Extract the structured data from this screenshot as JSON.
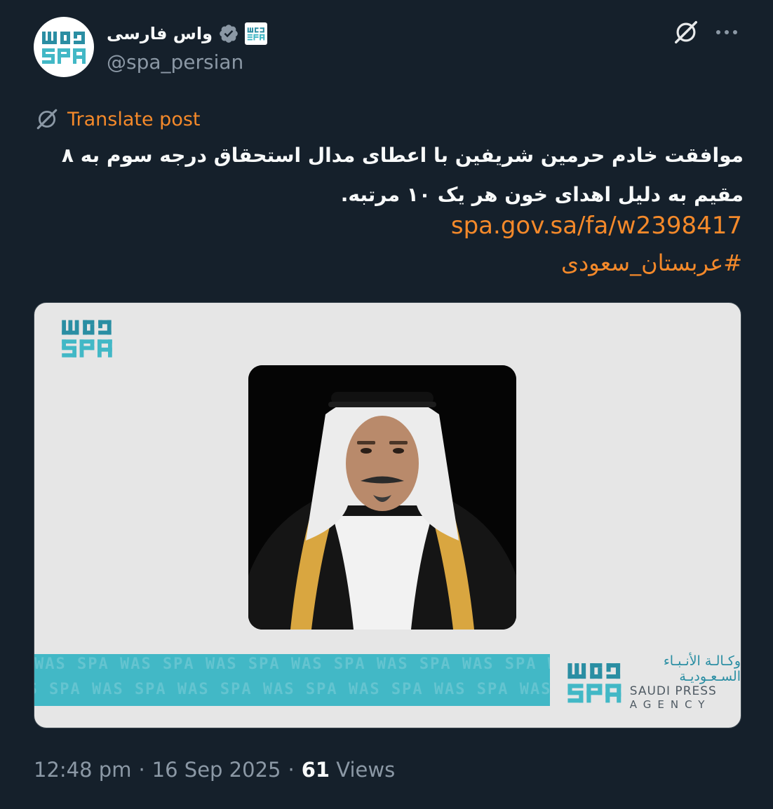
{
  "author": {
    "display_name": "واس فارسی",
    "handle": "@spa_persian",
    "verified": true,
    "avatar_mark": "WAS SPA"
  },
  "post": {
    "translate_label": "Translate post",
    "text": "موافقت خادم حرمین شریفین با اعطای مدال استحقاق درجه سوم به ۸ مقیم به دلیل اهدای خون هر یک ۱۰ مرتبه.",
    "link": "spa.gov.sa/fa/w2398417",
    "hashtag": "#عربستان_سعودی"
  },
  "media": {
    "logo_mark": "SPA",
    "agency_name_ar": "وكـالـة الأنـبـاء السـعـوديـة",
    "agency_name_en_1": "SAUDI PRESS",
    "agency_name_en_2": "AGENCY",
    "stripe_pattern": "WAS SPA WAS SPA WAS SPA WAS SPA WAS SPA WAS SPA WAS SPA"
  },
  "meta": {
    "time": "12:48 pm",
    "separator": "·",
    "date": "16 Sep 2025",
    "views_count": "61",
    "views_label": "Views"
  },
  "colors": {
    "background": "#15202b",
    "accent": "#f4892a",
    "verified": "#8b98a5",
    "brand_teal": "#2a8ea3"
  },
  "icons": [
    "grok-icon",
    "more-icon",
    "verified-icon",
    "translate-icon"
  ]
}
